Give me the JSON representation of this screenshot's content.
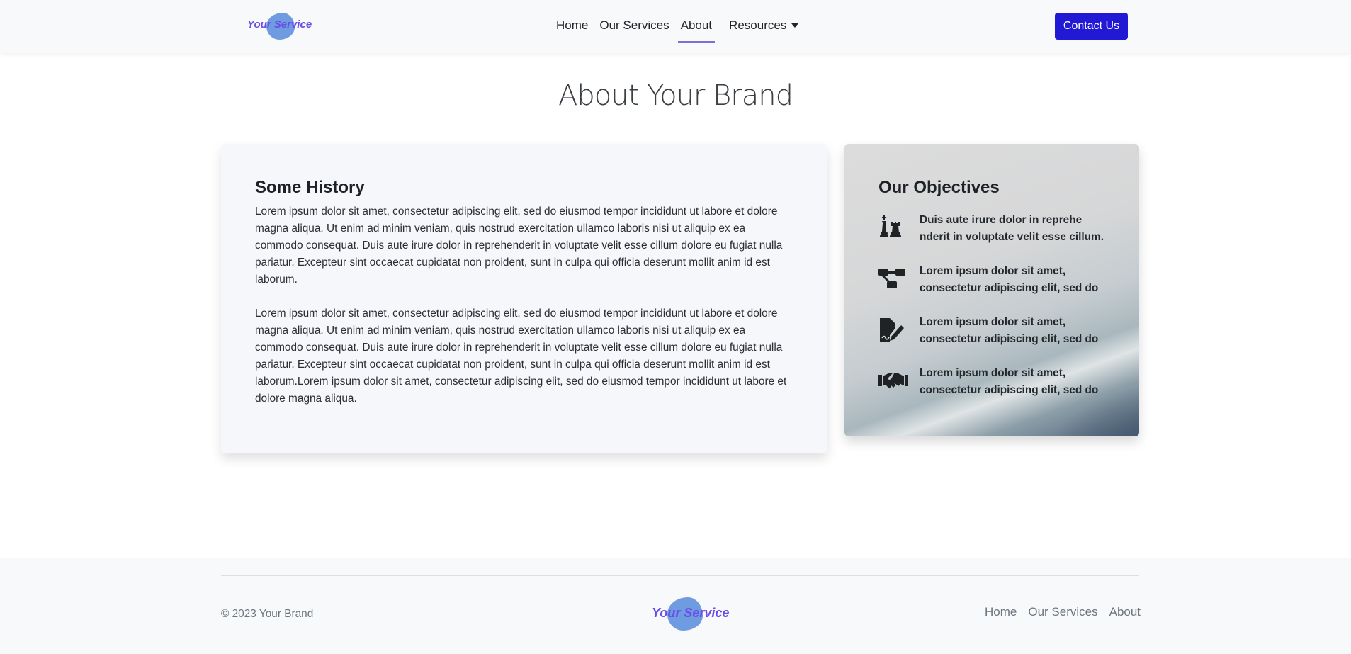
{
  "navbar": {
    "brand": "Your Service",
    "links": [
      {
        "label": "Home"
      },
      {
        "label": "Our Services"
      },
      {
        "label": "About"
      },
      {
        "label": "Resources"
      }
    ],
    "active": "About",
    "contact_label": "Contact Us"
  },
  "page": {
    "title": "About Your Brand"
  },
  "history": {
    "heading": "Some History",
    "paragraphs": [
      "Lorem ipsum dolor sit amet, consectetur adipiscing elit, sed do eiusmod tempor incididunt ut labore et dolore magna aliqua. Ut enim ad minim veniam, quis nostrud exercitation ullamco laboris nisi ut aliquip ex ea commodo consequat. Duis aute irure dolor in reprehenderit in voluptate velit esse cillum dolore eu fugiat nulla pariatur. Excepteur sint occaecat cupidatat non proident, sunt in culpa qui officia deserunt mollit anim id est laborum.",
      "Lorem ipsum dolor sit amet, consectetur adipiscing elit, sed do eiusmod tempor incididunt ut labore et dolore magna aliqua. Ut enim ad minim veniam, quis nostrud exercitation ullamco laboris nisi ut aliquip ex ea commodo consequat. Duis aute irure dolor in reprehenderit in voluptate velit esse cillum dolore eu fugiat nulla pariatur. Excepteur sint occaecat cupidatat non proident, sunt in culpa qui officia deserunt mollit anim id est laborum.Lorem ipsum dolor sit amet, consectetur adipiscing elit, sed do eiusmod tempor incididunt ut labore et dolore magna aliqua."
    ]
  },
  "objectives": {
    "heading": "Our Objectives",
    "items": [
      {
        "icon": "chess-icon",
        "text": "Duis aute irure dolor in reprehe nderit in voluptate velit esse cillum."
      },
      {
        "icon": "network-icon",
        "text": "Lorem ipsum dolor sit amet, consectetur adipiscing elit, sed do"
      },
      {
        "icon": "file-signature-icon",
        "text": "Lorem ipsum dolor sit amet, consectetur adipiscing elit, sed do"
      },
      {
        "icon": "handshake-icon",
        "text": "Lorem ipsum dolor sit amet, consectetur adipiscing elit, sed do"
      }
    ]
  },
  "footer": {
    "copyright": "© 2023 Your Brand",
    "brand": "Your Service",
    "links": [
      {
        "label": "Home"
      },
      {
        "label": "Our Services"
      },
      {
        "label": "About"
      }
    ]
  }
}
